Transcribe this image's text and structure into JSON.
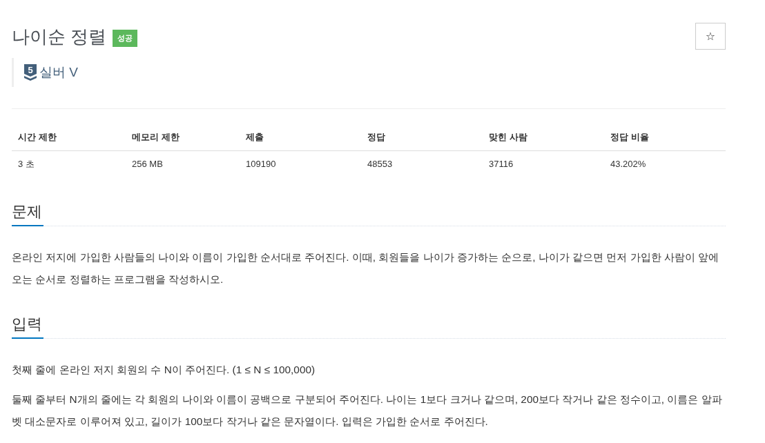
{
  "problem": {
    "title": "나이순 정렬",
    "result": {
      "label": "성공",
      "kind": "success"
    },
    "bookmark": {
      "label": "☆"
    }
  },
  "tier": {
    "number": "5",
    "label": "실버 V",
    "kind": "silver"
  },
  "stats_table": {
    "columns": [
      "시간 제한",
      "메모리 제한",
      "제출",
      "정답",
      "맞힌 사람",
      "정답 비율"
    ],
    "rows": [
      [
        "3 초",
        "256 MB",
        "109190",
        "48553",
        "37116",
        "43.202%"
      ]
    ]
  },
  "sections": [
    {
      "heading": "문제",
      "paragraphs": [
        "온라인 저지에 가입한 사람들의 나이와 이름이 가입한 순서대로 주어진다. 이때, 회원들을 나이가 증가하는 순으로, 나이가 같으면 먼저 가입한 사람이 앞에 오는 순서로 정렬하는 프로그램을 작성하시오."
      ]
    },
    {
      "heading": "입력",
      "paragraphs": [
        "첫째 줄에 온라인 저지 회원의 수 N이 주어진다. (1 ≤ N ≤ 100,000)",
        "둘째 줄부터 N개의 줄에는 각 회원의 나이와 이름이 공백으로 구분되어 주어진다. 나이는 1보다 크거나 같으며, 200보다 작거나 같은 정수이고, 이름은 알파벳 대소문자로 이루어져 있고, 길이가 100보다 작거나 같은 문자열이다. 입력은 가입한 순서로 주어진다."
      ]
    }
  ]
}
